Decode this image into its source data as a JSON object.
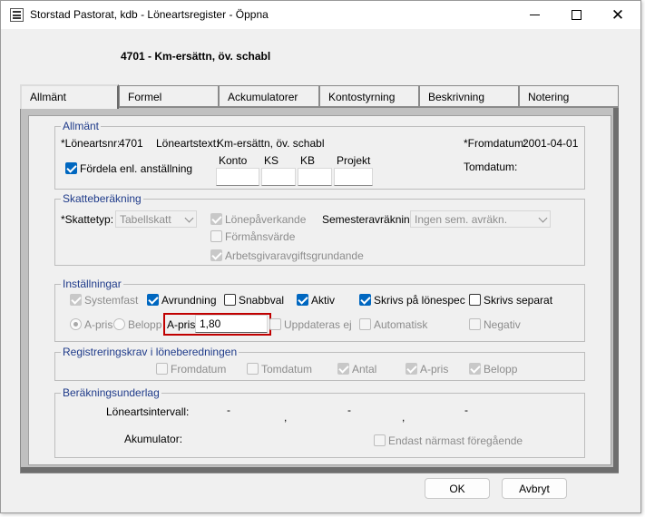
{
  "window": {
    "title": "Storstad Pastorat, kdb  - Löneartsregister - Öppna",
    "minimize": "—",
    "maximize": "☐",
    "close": "✕"
  },
  "header": {
    "title": "4701 - Km-ersättn, öv. schabl"
  },
  "tabs": [
    {
      "label": "Allmänt",
      "active": true
    },
    {
      "label": "Formel"
    },
    {
      "label": "Ackumulatorer"
    },
    {
      "label": "Kontostyrning"
    },
    {
      "label": "Beskrivning"
    },
    {
      "label": "Notering"
    }
  ],
  "allmant": {
    "legend": "Allmänt",
    "loneartsnr_label": "*Löneartsnr:",
    "loneartsnr_value": "4701",
    "loneartstext_label": "Löneartstext:",
    "loneartstext_value": "Km-ersättn, öv. schabl",
    "fromdatum_label": "*Fromdatum:",
    "fromdatum_value": "2001-04-01",
    "tomdatum_label": "Tomdatum:",
    "fordela_label": "Fördela enl. anställning",
    "konto_label": "Konto",
    "ks_label": "KS",
    "kb_label": "KB",
    "projekt_label": "Projekt"
  },
  "skatt": {
    "legend": "Skatteberäkning",
    "skattetyp_label": "*Skattetyp:",
    "skattetyp_value": "Tabellskatt",
    "lonepaverkande": "Lönepåverkande",
    "formansvarde": "Förmånsvärde",
    "arbetsgivar": "Arbetsgivaravgiftsgrundande",
    "semester_label": "Semesteravräkning:",
    "semester_value": "Ingen sem. avräkn."
  },
  "installningar": {
    "legend": "Inställningar",
    "systemfast": "Systemfast",
    "avrundning": "Avrundning",
    "snabbval": "Snabbval",
    "aktiv": "Aktiv",
    "skrivs_lonespec": "Skrivs på lönespec",
    "skrivs_separat": "Skrivs separat",
    "radio_apris": "A-pris",
    "radio_belopp": "Belopp",
    "apris_label": "A-pris:",
    "apris_value": "1,80",
    "uppdateras": "Uppdateras ej",
    "automatisk": "Automatisk",
    "negativ": "Negativ"
  },
  "registrering": {
    "legend": "Registreringskrav i löneberedningen",
    "fromdatum": "Fromdatum",
    "tomdatum": "Tomdatum",
    "antal": "Antal",
    "apris": "A-pris",
    "belopp": "Belopp"
  },
  "berakning": {
    "legend": "Beräkningsunderlag",
    "intervall_label": "Löneartsintervall:",
    "dash": "-",
    "comma": ",",
    "ackumulator_label": "Akumulator:",
    "endast": "Endast närmast föregående"
  },
  "buttons": {
    "ok": "OK",
    "avbryt": "Avbryt"
  }
}
